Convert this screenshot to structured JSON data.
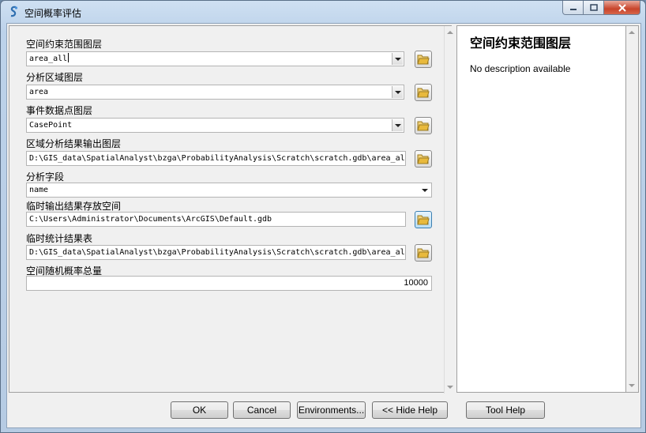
{
  "window": {
    "title": "空间概率评估"
  },
  "params": [
    {
      "label": "空间约束范围图层",
      "value": "area_all",
      "type": "combo"
    },
    {
      "label": "分析区域图层",
      "value": "area",
      "type": "combo"
    },
    {
      "label": "事件数据点图层",
      "value": "CasePoint",
      "type": "combo"
    },
    {
      "label": "区域分析结果输出图层",
      "value": "D:\\GIS_data\\SpatialAnalyst\\bzga\\ProbabilityAnalysis\\Scratch\\scratch.gdb\\area_all",
      "type": "path"
    },
    {
      "label": "分析字段",
      "value": "name",
      "type": "select"
    },
    {
      "label": "临时输出结果存放空间",
      "value": "C:\\Users\\Administrator\\Documents\\ArcGIS\\Default.gdb",
      "type": "path"
    },
    {
      "label": "临时统计结果表",
      "value": "D:\\GIS_data\\SpatialAnalyst\\bzga\\ProbabilityAnalysis\\Scratch\\scratch.gdb\\area_all",
      "type": "path"
    },
    {
      "label": "空间随机概率总量",
      "value": "10000",
      "type": "number"
    }
  ],
  "help": {
    "title": "空间约束范围图层",
    "description": "No description available"
  },
  "buttons": {
    "ok": "OK",
    "cancel": "Cancel",
    "environments": "Environments...",
    "hide_help": "<< Hide Help",
    "tool_help": "Tool Help"
  },
  "icons": {
    "app": "arctoolbox-script-icon",
    "browse": "folder-open-icon"
  },
  "colors": {
    "folder": "#e8b93c",
    "close_button": "#c8442b",
    "frame": "#bcd2ea"
  }
}
